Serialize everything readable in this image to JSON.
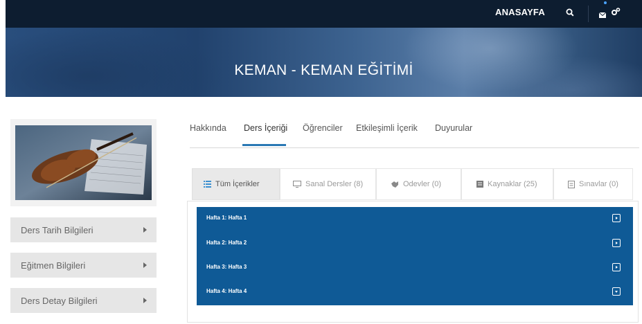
{
  "header": {
    "home_label": "ANASAYFA",
    "icons": [
      "search-icon",
      "mail-icon",
      "gear-icon"
    ]
  },
  "banner": {
    "title": "KEMAN - KEMAN EĞİTİMİ"
  },
  "sidebar": {
    "image": "violin-image",
    "items": [
      {
        "label": "Ders Tarih Bilgileri"
      },
      {
        "label": "Eğitmen Bilgileri"
      },
      {
        "label": "Ders Detay Bilgileri"
      }
    ]
  },
  "tabs": [
    {
      "label": "Hakkında"
    },
    {
      "label": "Ders İçeriği",
      "active": true
    },
    {
      "label": "Öğrenciler"
    },
    {
      "label": "Etkileşimli İçerik"
    },
    {
      "label": "Duyurular"
    }
  ],
  "filters": [
    {
      "label": "Tüm İçerikler",
      "icon": "list-icon",
      "active": true
    },
    {
      "label": "Sanal Dersler (8)",
      "icon": "monitor-icon"
    },
    {
      "label": "Odevler (0)",
      "icon": "puzzle-icon"
    },
    {
      "label": "Kaynaklar (25)",
      "icon": "book-icon"
    },
    {
      "label": "Sınavlar (0)",
      "icon": "document-icon"
    }
  ],
  "weeks": [
    {
      "label": "Hafta 1: Hafta 1",
      "state": "collapsed"
    },
    {
      "label": "Hafta 2: Hafta 2",
      "state": "collapsed"
    },
    {
      "label": "Hafta 3: Hafta 3",
      "state": "collapsed"
    },
    {
      "label": "Hafta 4: Hafta 4",
      "state": "expanded"
    }
  ],
  "colors": {
    "topbar": "#0d1d30",
    "accent": "#2a79b4",
    "week_bg": "#0f5a96",
    "sidebar_item_bg": "#e6e6e6"
  }
}
